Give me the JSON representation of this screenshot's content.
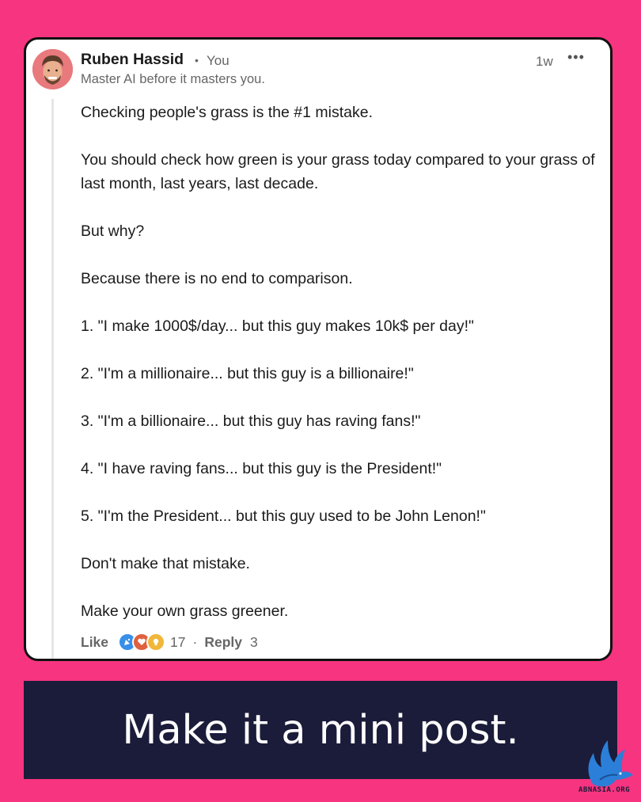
{
  "post": {
    "author": "Ruben Hassid",
    "relation": "You",
    "tagline": "Master AI before it masters you.",
    "time": "1w",
    "more_label": "•••",
    "paragraphs": [
      "Checking people's grass is the #1 mistake.",
      "You should check how green is your grass today compared to your grass of last month, last years, last decade.",
      "But why?",
      "Because there is no end to comparison.",
      "1. \"I make 1000$/day... but this guy makes 10k$ per day!\"",
      "2. \"I'm a millionaire... but this guy is a billionaire!\"",
      "3. \"I'm a billionaire... but this guy has raving fans!\"",
      "4. \"I have raving fans... but this guy is the President!\"",
      "5. \"I'm the President... but this guy used to be John Lenon!\"",
      "Don't make that mistake.",
      "Make your own grass greener."
    ],
    "actions": {
      "like_label": "Like",
      "reaction_count": "17",
      "separator": "·",
      "reply_label": "Reply",
      "reply_count": "3"
    },
    "reaction_icons": [
      "celebrate-icon",
      "love-icon",
      "insightful-icon"
    ],
    "reaction_colors": [
      "#378fe9",
      "#e0603f",
      "#f0b73a"
    ]
  },
  "banner": {
    "text": "Make it a mini post."
  },
  "watermark": {
    "text": "ABNASIA.ORG"
  },
  "colors": {
    "background": "#f7347f",
    "banner": "#1b1c3a"
  }
}
